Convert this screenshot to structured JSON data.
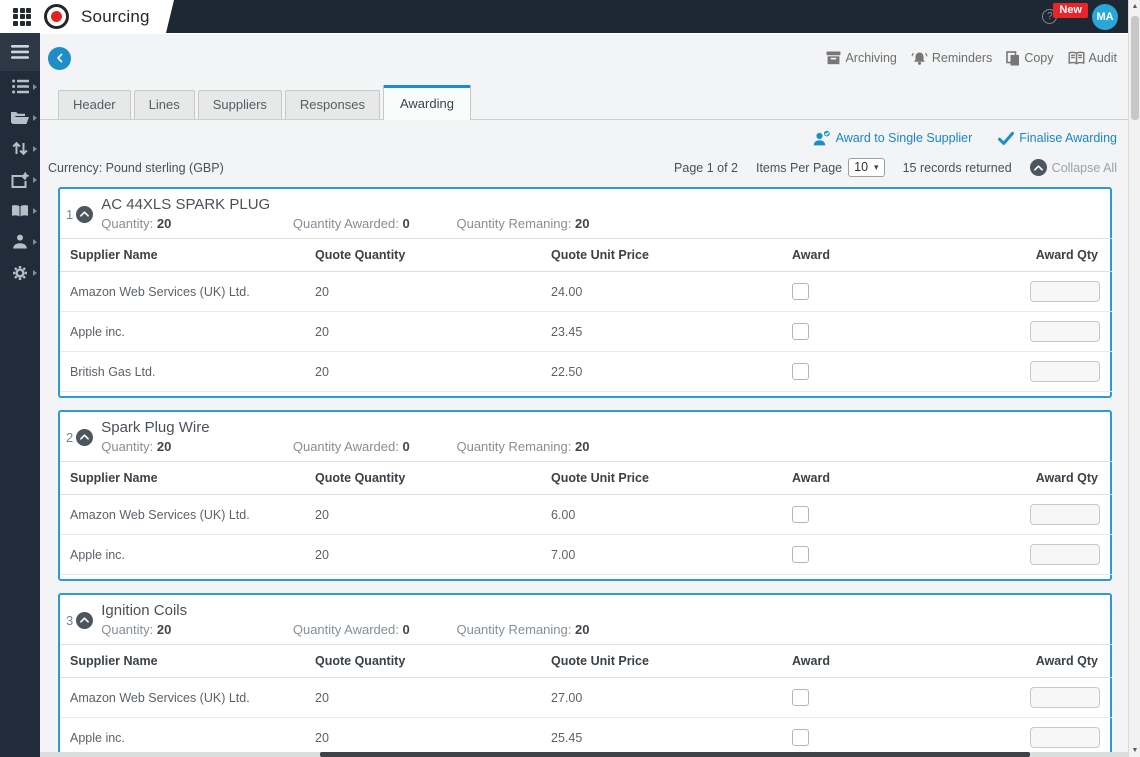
{
  "app": {
    "title": "Sourcing",
    "help": "?",
    "new_badge": "New",
    "avatar_initials": "MA"
  },
  "toolbar": {
    "archiving": "Archiving",
    "reminders": "Reminders",
    "copy": "Copy",
    "audit": "Audit"
  },
  "tabs": [
    {
      "label": "Header"
    },
    {
      "label": "Lines"
    },
    {
      "label": "Suppliers"
    },
    {
      "label": "Responses"
    },
    {
      "label": "Awarding"
    }
  ],
  "award_bar": {
    "award_single": "Award to Single Supplier",
    "finalise": "Finalise Awarding"
  },
  "info_bar": {
    "currency": "Currency: Pound sterling (GBP)",
    "page": "Page 1 of 2",
    "items_per_page_label": "Items Per Page",
    "items_per_page_value": "10",
    "records": "15 records returned",
    "collapse_all": "Collapse All"
  },
  "table": {
    "columns": [
      "Supplier Name",
      "Quote Quantity",
      "Quote Unit Price",
      "Award",
      "Award Qty"
    ]
  },
  "items": [
    {
      "number": "1",
      "title": "AC 44XLS SPARK PLUG",
      "quantity_label": "Quantity:",
      "quantity": "20",
      "awarded_label": "Quantity Awarded:",
      "awarded": "0",
      "remaining_label": "Quantity Remaning:",
      "remaining": "20",
      "rows": [
        {
          "supplier": "Amazon Web Services (UK) Ltd.",
          "quote_quantity": "20",
          "quote_unit_price": "24.00"
        },
        {
          "supplier": "Apple inc.",
          "quote_quantity": "20",
          "quote_unit_price": "23.45"
        },
        {
          "supplier": "British Gas Ltd.",
          "quote_quantity": "20",
          "quote_unit_price": "22.50"
        }
      ]
    },
    {
      "number": "2",
      "title": "Spark Plug Wire",
      "quantity_label": "Quantity:",
      "quantity": "20",
      "awarded_label": "Quantity Awarded:",
      "awarded": "0",
      "remaining_label": "Quantity Remaning:",
      "remaining": "20",
      "rows": [
        {
          "supplier": "Amazon Web Services (UK) Ltd.",
          "quote_quantity": "20",
          "quote_unit_price": "6.00"
        },
        {
          "supplier": "Apple inc.",
          "quote_quantity": "20",
          "quote_unit_price": "7.00"
        }
      ]
    },
    {
      "number": "3",
      "title": "Ignition Coils",
      "quantity_label": "Quantity:",
      "quantity": "20",
      "awarded_label": "Quantity Awarded:",
      "awarded": "0",
      "remaining_label": "Quantity Remaning:",
      "remaining": "20",
      "rows": [
        {
          "supplier": "Amazon Web Services (UK) Ltd.",
          "quote_quantity": "20",
          "quote_unit_price": "27.00"
        },
        {
          "supplier": "Apple inc.",
          "quote_quantity": "20",
          "quote_unit_price": "25.45"
        }
      ]
    }
  ],
  "colors": {
    "accent_blue": "#1d8ec9",
    "card_border": "#2d9bd3",
    "badge_red": "#e9252b",
    "avatar_blue": "#2aa7d8",
    "logo_red": "#e02424",
    "topbar_dark": "#1d2834",
    "sidebar_dark": "#202c39"
  }
}
